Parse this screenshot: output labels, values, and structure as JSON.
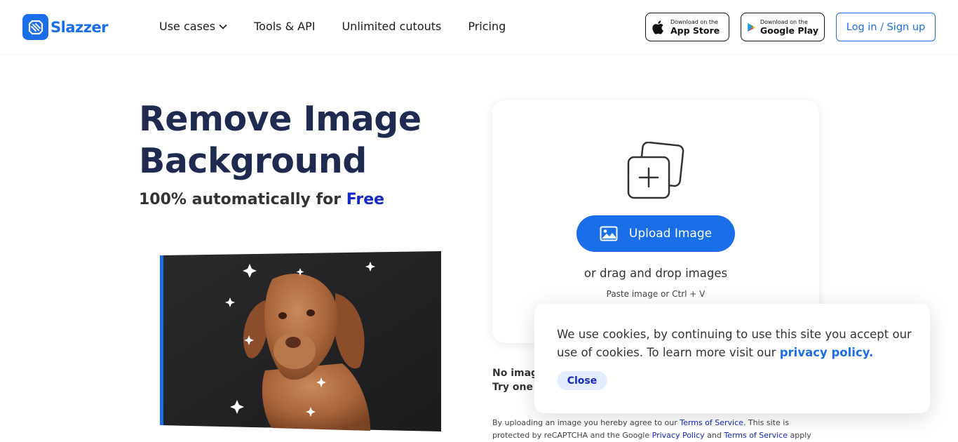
{
  "brand": {
    "name": "Slazzer",
    "accent": "#1a6ee8",
    "dark_blue": "#1427c8",
    "heading_color": "#1e2a4f"
  },
  "nav": {
    "items": [
      {
        "label": "Use cases",
        "has_dropdown": true
      },
      {
        "label": "Tools & API"
      },
      {
        "label": "Unlimited cutouts"
      },
      {
        "label": "Pricing"
      }
    ]
  },
  "stores": {
    "apple": {
      "small": "Download on the",
      "big": "App Store",
      "icon": "apple-icon"
    },
    "google": {
      "small": "Download on the",
      "big": "Google Play",
      "icon": "google-play-icon"
    }
  },
  "auth": {
    "login_label": "Log in / Sign up"
  },
  "hero": {
    "title": "Remove Image Background",
    "subtitle_prefix": "100% automatically for ",
    "subtitle_highlight": "Free"
  },
  "upload": {
    "button_label": "Upload Image",
    "drag_text": "or drag and drop images",
    "paste_text": "Paste image or Ctrl + V"
  },
  "no_image": {
    "line1": "No image?",
    "line2": "Try one of these:"
  },
  "legal": {
    "prefix": "By uploading an image you hereby agree to our ",
    "tos": "Terms of Service",
    "middle": ". This site is protected by reCAPTCHA and the Google ",
    "privacy": "Privacy Policy",
    "and": " and ",
    "tos2": "Terms of Service",
    "suffix": " apply"
  },
  "cookie": {
    "text": "We use cookies, by continuing to use this site you accept our use of cookies.  To learn more visit our ",
    "link": "privacy policy.",
    "close_label": "Close"
  }
}
